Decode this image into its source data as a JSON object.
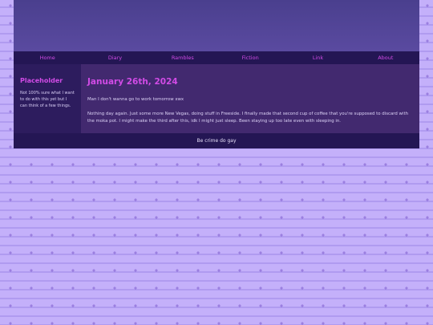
{
  "nav": {
    "items": [
      "Home",
      "Diary",
      "Rambles",
      "Fiction",
      "Link",
      "About"
    ]
  },
  "sidebar": {
    "title": "Placeholder",
    "text": "Not 100% sure what I want to do with this yet but I can think of a few things."
  },
  "post": {
    "title": "January 26th, 2024",
    "paragraphs": [
      "Man I don't wanna go to work tomorrow xwx",
      "Nothing day again. Just some more New Vegas, doing stuff in Freeside. I finally made that second cup of coffee that you're supposed to discard with the moka pot. I might make the third after this, idk I might just sleep. Been staying up too late even with sleeping in."
    ]
  },
  "footer": {
    "text": "Be crime do gay"
  }
}
